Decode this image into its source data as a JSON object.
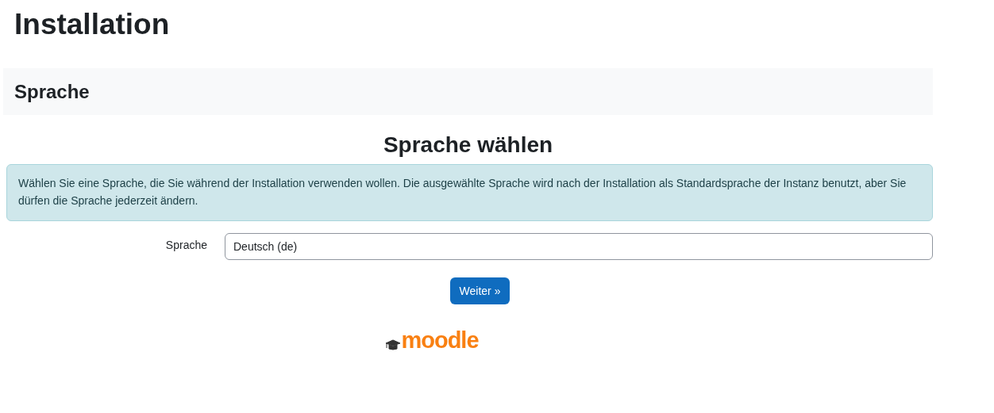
{
  "page": {
    "title": "Installation"
  },
  "section": {
    "title": "Sprache"
  },
  "form": {
    "heading": "Sprache wählen",
    "info": "Wählen Sie eine Sprache, die Sie während der Installation verwenden wollen. Die ausgewählte Sprache wird nach der Installation als Standardsprache der Instanz benutzt, aber Sie dürfen die Sprache jederzeit ändern.",
    "fields": [
      {
        "label": "Sprache",
        "value": "Deutsch (de)"
      }
    ],
    "buttons": [
      "Weiter »"
    ]
  },
  "footer": {
    "logo": "moodle"
  }
}
